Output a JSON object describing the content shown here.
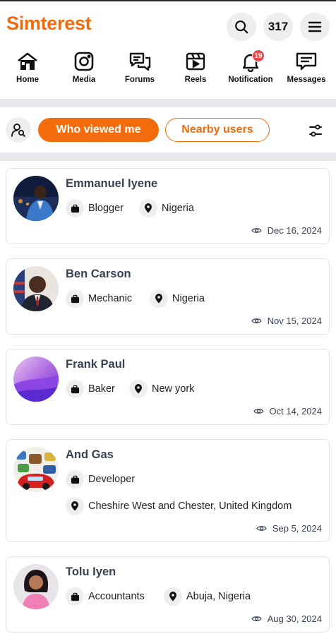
{
  "app": {
    "brand": "Simterest",
    "brand_color": "#f26c0d"
  },
  "header": {
    "search_icon": "search-icon",
    "coins": "317",
    "menu_icon": "hamburger-menu-icon"
  },
  "nav": {
    "items": [
      {
        "label": "Home",
        "icon": "home-icon"
      },
      {
        "label": "Media",
        "icon": "media-icon"
      },
      {
        "label": "Forums",
        "icon": "forums-icon"
      },
      {
        "label": "Reels",
        "icon": "reels-icon"
      },
      {
        "label": "Notification",
        "icon": "bell-icon",
        "badge": "19"
      },
      {
        "label": "Messages",
        "icon": "messages-icon"
      }
    ]
  },
  "filters": {
    "user_search_icon": "user-search-icon",
    "tabs": [
      {
        "label": "Who viewed me",
        "active": true
      },
      {
        "label": "Nearby users",
        "active": false
      }
    ],
    "settings_icon": "sliders-icon"
  },
  "viewers": [
    {
      "name": "Emmanuel Iyene",
      "occupation": "Blogger",
      "location": "Nigeria",
      "date": "Dec 16, 2024"
    },
    {
      "name": "Ben Carson",
      "occupation": "Mechanic",
      "location": "Nigeria",
      "date": "Nov 15, 2024"
    },
    {
      "name": "Frank Paul",
      "occupation": "Baker",
      "location": "New york",
      "date": "Oct 14, 2024"
    },
    {
      "name": "And Gas",
      "occupation": "Developer",
      "location": "Cheshire West and Chester, United Kingdom",
      "date": "Sep 5, 2024"
    },
    {
      "name": "Tolu Iyen",
      "occupation": "Accountants",
      "location": "Abuja, Nigeria",
      "date": "Aug 30, 2024"
    }
  ]
}
